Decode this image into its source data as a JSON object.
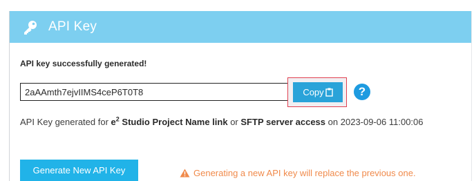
{
  "panel": {
    "title": "API Key",
    "header_color": "#7dcff0",
    "header_icon": "key-icon"
  },
  "result": {
    "success_message": "API key successfully generated!",
    "api_key_value": "2aAAmth7ejvIIMS4ceP6T0T8",
    "copy_label": "Copy",
    "copy_icon": "clipboard-icon",
    "help_icon": "question-circle-icon",
    "help_symbol": "?"
  },
  "info": {
    "prefix": "API Key generated for",
    "brand_e": "e",
    "brand_sup": "2",
    "project": "Studio Project Name link",
    "connector": "or",
    "access": "SFTP server access",
    "date_prefix": "on",
    "timestamp": "2023-09-06 11:00:06"
  },
  "actions": {
    "generate_label": "Generate New API Key",
    "warning_icon": "warning-triangle-icon",
    "warning_text": "Generating a new API key will replace the previous one."
  },
  "colors": {
    "primary_button": "#21b3e8",
    "copy_button": "#2aa3d9",
    "highlight_border": "#e04050",
    "warning": "#f08a4b",
    "help": "#1e9be0"
  }
}
